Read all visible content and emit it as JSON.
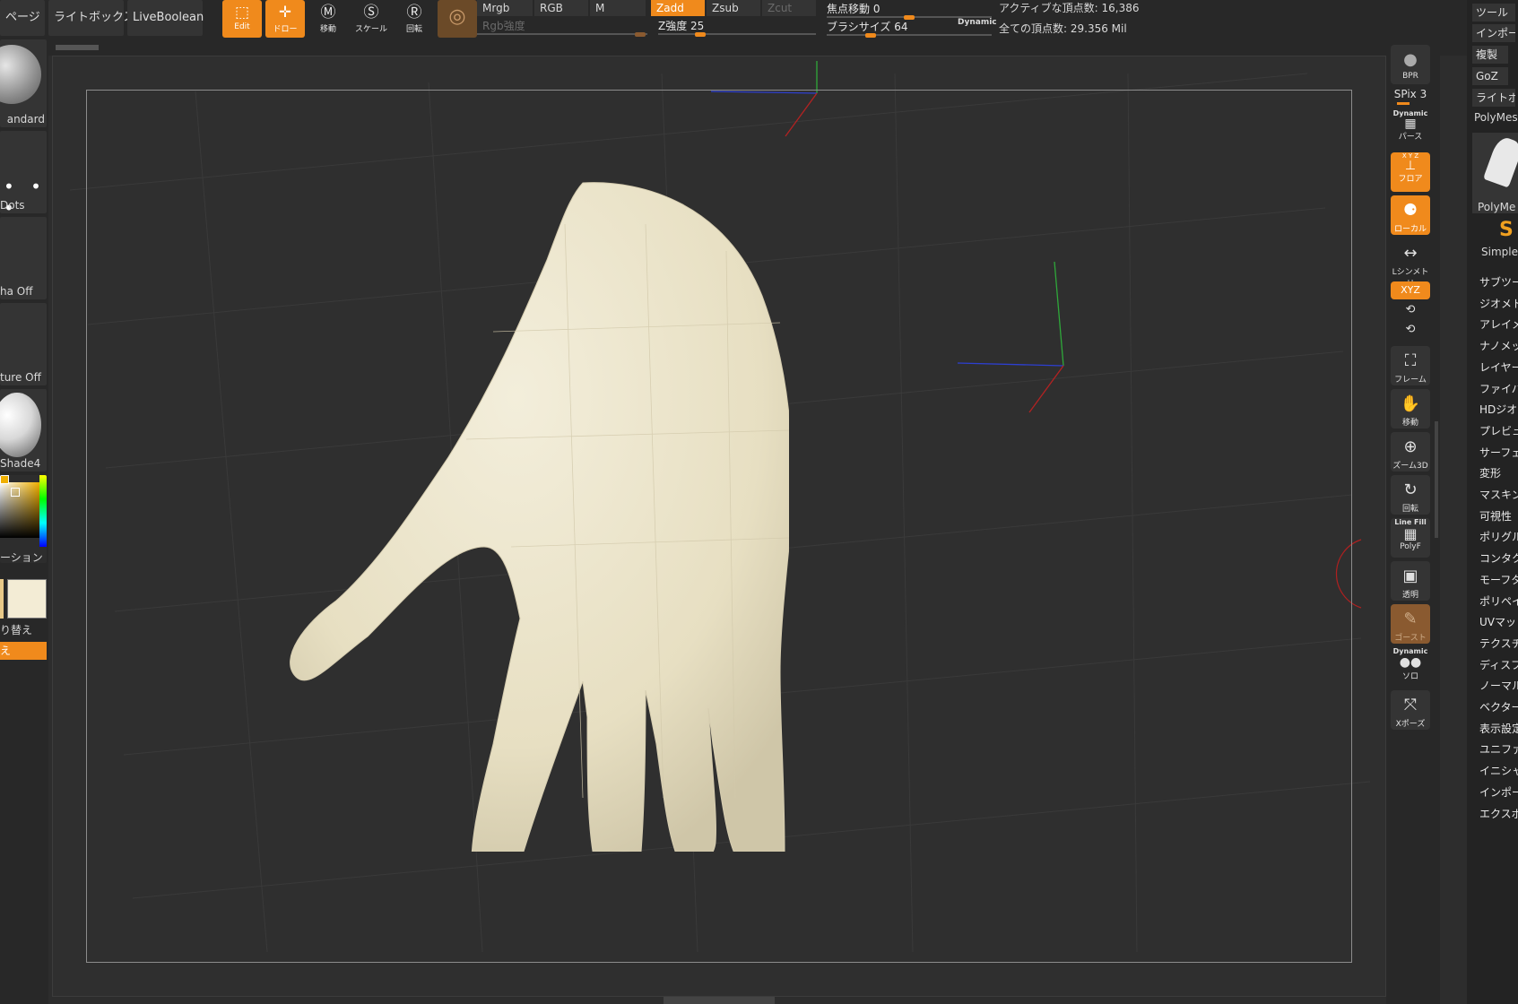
{
  "top": {
    "tabs": [
      "ページ",
      "ライトボックス",
      "LiveBoolean"
    ],
    "tools": [
      {
        "label": "Edit",
        "icon": "edit-icon",
        "active": true
      },
      {
        "label": "ドロー",
        "icon": "draw-icon",
        "active": true
      },
      {
        "label": "移動",
        "icon": "move-icon",
        "active": false
      },
      {
        "label": "スケール",
        "icon": "scale-icon",
        "active": false
      },
      {
        "label": "回転",
        "icon": "rotate-icon",
        "active": false
      }
    ],
    "channels_row1": [
      "Mrgb",
      "RGB",
      "M"
    ],
    "channels_row2": [
      "Zadd",
      "Zsub",
      "Zcut"
    ],
    "rgb_intensity_label": "Rgb強度",
    "z_intensity_label": "Z強度 25",
    "z_intensity_value": 25,
    "focal_shift_label": "焦点移動 0",
    "focal_shift_value": 0,
    "brush_size_label": "ブラシサイズ 64",
    "brush_size_value": 64,
    "dynamic_label": "Dynamic",
    "active_points": "アクティブな頂点数: 16,386",
    "total_points": "全ての頂点数: 29.356 Mil"
  },
  "left": {
    "brush_label": "andard",
    "stroke_label": "Dots",
    "alpha_label": "ha Off",
    "texture_label": "ture Off",
    "material_label": "Shade4",
    "gradient_label": "ーション",
    "switch_label": "り替え",
    "alternate_label": "え"
  },
  "right_tools": {
    "bpr": "BPR",
    "spix": "SPix 3",
    "dynamic": "Dynamic",
    "persp": "パース",
    "xyz_small": "X Y Z",
    "floor": "フロア",
    "local": "ローカル",
    "lsym": "Lシンメトリ",
    "xyz": "XYZ",
    "frame": "フレーム",
    "move": "移動",
    "zoom": "ズーム3D",
    "rotate": "回転",
    "linefill": "Line Fill",
    "polyf": "PolyF",
    "transp": "透明",
    "ghost": "ゴースト",
    "dynamic2": "Dynamic",
    "solo": "ソロ",
    "xpose": "Xポーズ"
  },
  "palette": {
    "buttons": [
      "ツール",
      "インポー",
      "複製",
      "GoZ",
      "ライトボ"
    ],
    "polymesh_label": "PolyMesh",
    "thumb_label": "PolyMe",
    "simple_label": "Simple",
    "menu": [
      "サブツー",
      "ジオメト",
      "アレイメ",
      "ナノメッ",
      "レイヤー",
      "ファイバ",
      "HDジオ",
      "プレビュ",
      "サーフェ",
      "変形",
      "マスキン",
      "可視性",
      "ポリグル",
      "コンタク",
      "モーフタ",
      "ポリペイ",
      "UVマッ",
      "テクスチ",
      "ディスプ",
      "ノーマル",
      "ベクター",
      "表示設定",
      "ユニファ",
      "イニシャ",
      "インポー",
      "エクスポ"
    ]
  },
  "colors": {
    "accent": "#f08a1c",
    "mesh": "#ece6cf",
    "background": "#2d2d2d"
  }
}
